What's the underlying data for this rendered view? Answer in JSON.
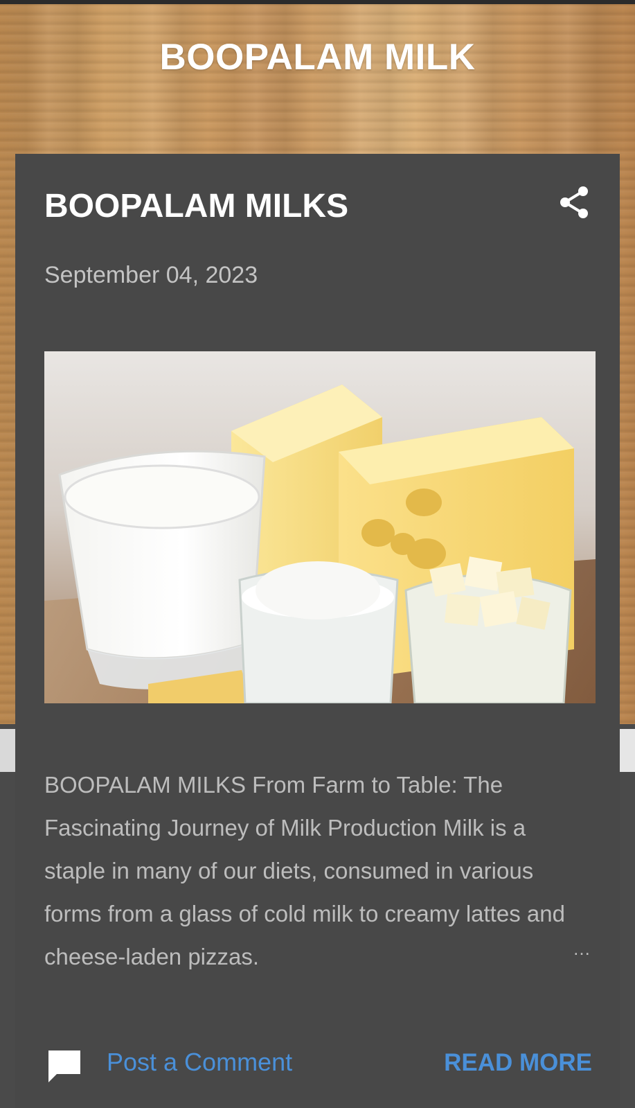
{
  "header": {
    "blog_title": "BOOPALAM MILK"
  },
  "post": {
    "title": "BOOPALAM MILKS",
    "date": "September 04, 2023",
    "snippet": "BOOPALAM MILKS  From Farm to Table: The Fascinating Journey of Milk Production Milk is a staple in many of our diets, consumed in various forms from a glass of cold milk to creamy lattes and cheese-laden pizzas.",
    "ellipsis": "…",
    "share_icon": "share-icon",
    "image_icon": "dairy-products-image"
  },
  "footer": {
    "comment_icon": "comment-icon",
    "post_comment_label": "Post a Comment",
    "read_more_label": "READ MORE"
  },
  "colors": {
    "card_bg": "#484848",
    "link": "#4a90d9",
    "title": "#ffffff",
    "meta": "#c4c4c4"
  }
}
